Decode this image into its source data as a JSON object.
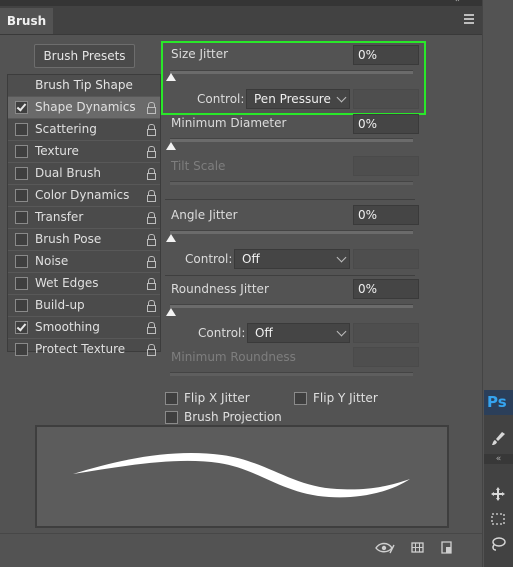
{
  "panel": {
    "tab_label": "Brush",
    "presets_button": "Brush Presets"
  },
  "brush_list": {
    "tip_shape": "Brush Tip Shape",
    "items": [
      {
        "label": "Shape Dynamics",
        "checked": true,
        "selected": true
      },
      {
        "label": "Scattering",
        "checked": false
      },
      {
        "label": "Texture",
        "checked": false
      },
      {
        "label": "Dual Brush",
        "checked": false
      },
      {
        "label": "Color Dynamics",
        "checked": false
      },
      {
        "label": "Transfer",
        "checked": false
      },
      {
        "label": "Brush Pose",
        "checked": false
      },
      {
        "label": "Noise",
        "checked": false
      },
      {
        "label": "Wet Edges",
        "checked": false
      },
      {
        "label": "Build-up",
        "checked": false
      },
      {
        "label": "Smoothing",
        "checked": true
      },
      {
        "label": "Protect Texture",
        "checked": false
      }
    ]
  },
  "settings": {
    "size_jitter": {
      "label": "Size Jitter",
      "value": "0%",
      "control_label": "Control:",
      "control_value": "Pen Pressure"
    },
    "min_diameter": {
      "label": "Minimum Diameter",
      "value": "0%"
    },
    "tilt_scale": {
      "label": "Tilt Scale"
    },
    "angle_jitter": {
      "label": "Angle Jitter",
      "value": "0%",
      "control_label": "Control:",
      "control_value": "Off"
    },
    "roundness_jitter": {
      "label": "Roundness Jitter",
      "value": "0%",
      "control_label": "Control:",
      "control_value": "Off"
    },
    "min_roundness": {
      "label": "Minimum Roundness"
    },
    "flip_x": {
      "label": "Flip X Jitter",
      "checked": false
    },
    "flip_y": {
      "label": "Flip Y Jitter",
      "checked": false
    },
    "brush_projection": {
      "label": "Brush Projection",
      "checked": false
    }
  },
  "sidebar": {
    "logo_text": "Ps"
  },
  "colors": {
    "highlight": "#29e829",
    "panel_bg": "#535353",
    "ps_blue": "#35a4f0"
  },
  "icons": [
    "panel-menu-icon",
    "lock-icon",
    "eye-icon",
    "grid-icon",
    "new-page-icon",
    "move-tool-icon",
    "marquee-tool-icon",
    "lasso-tool-icon",
    "brush-tool-icon"
  ]
}
